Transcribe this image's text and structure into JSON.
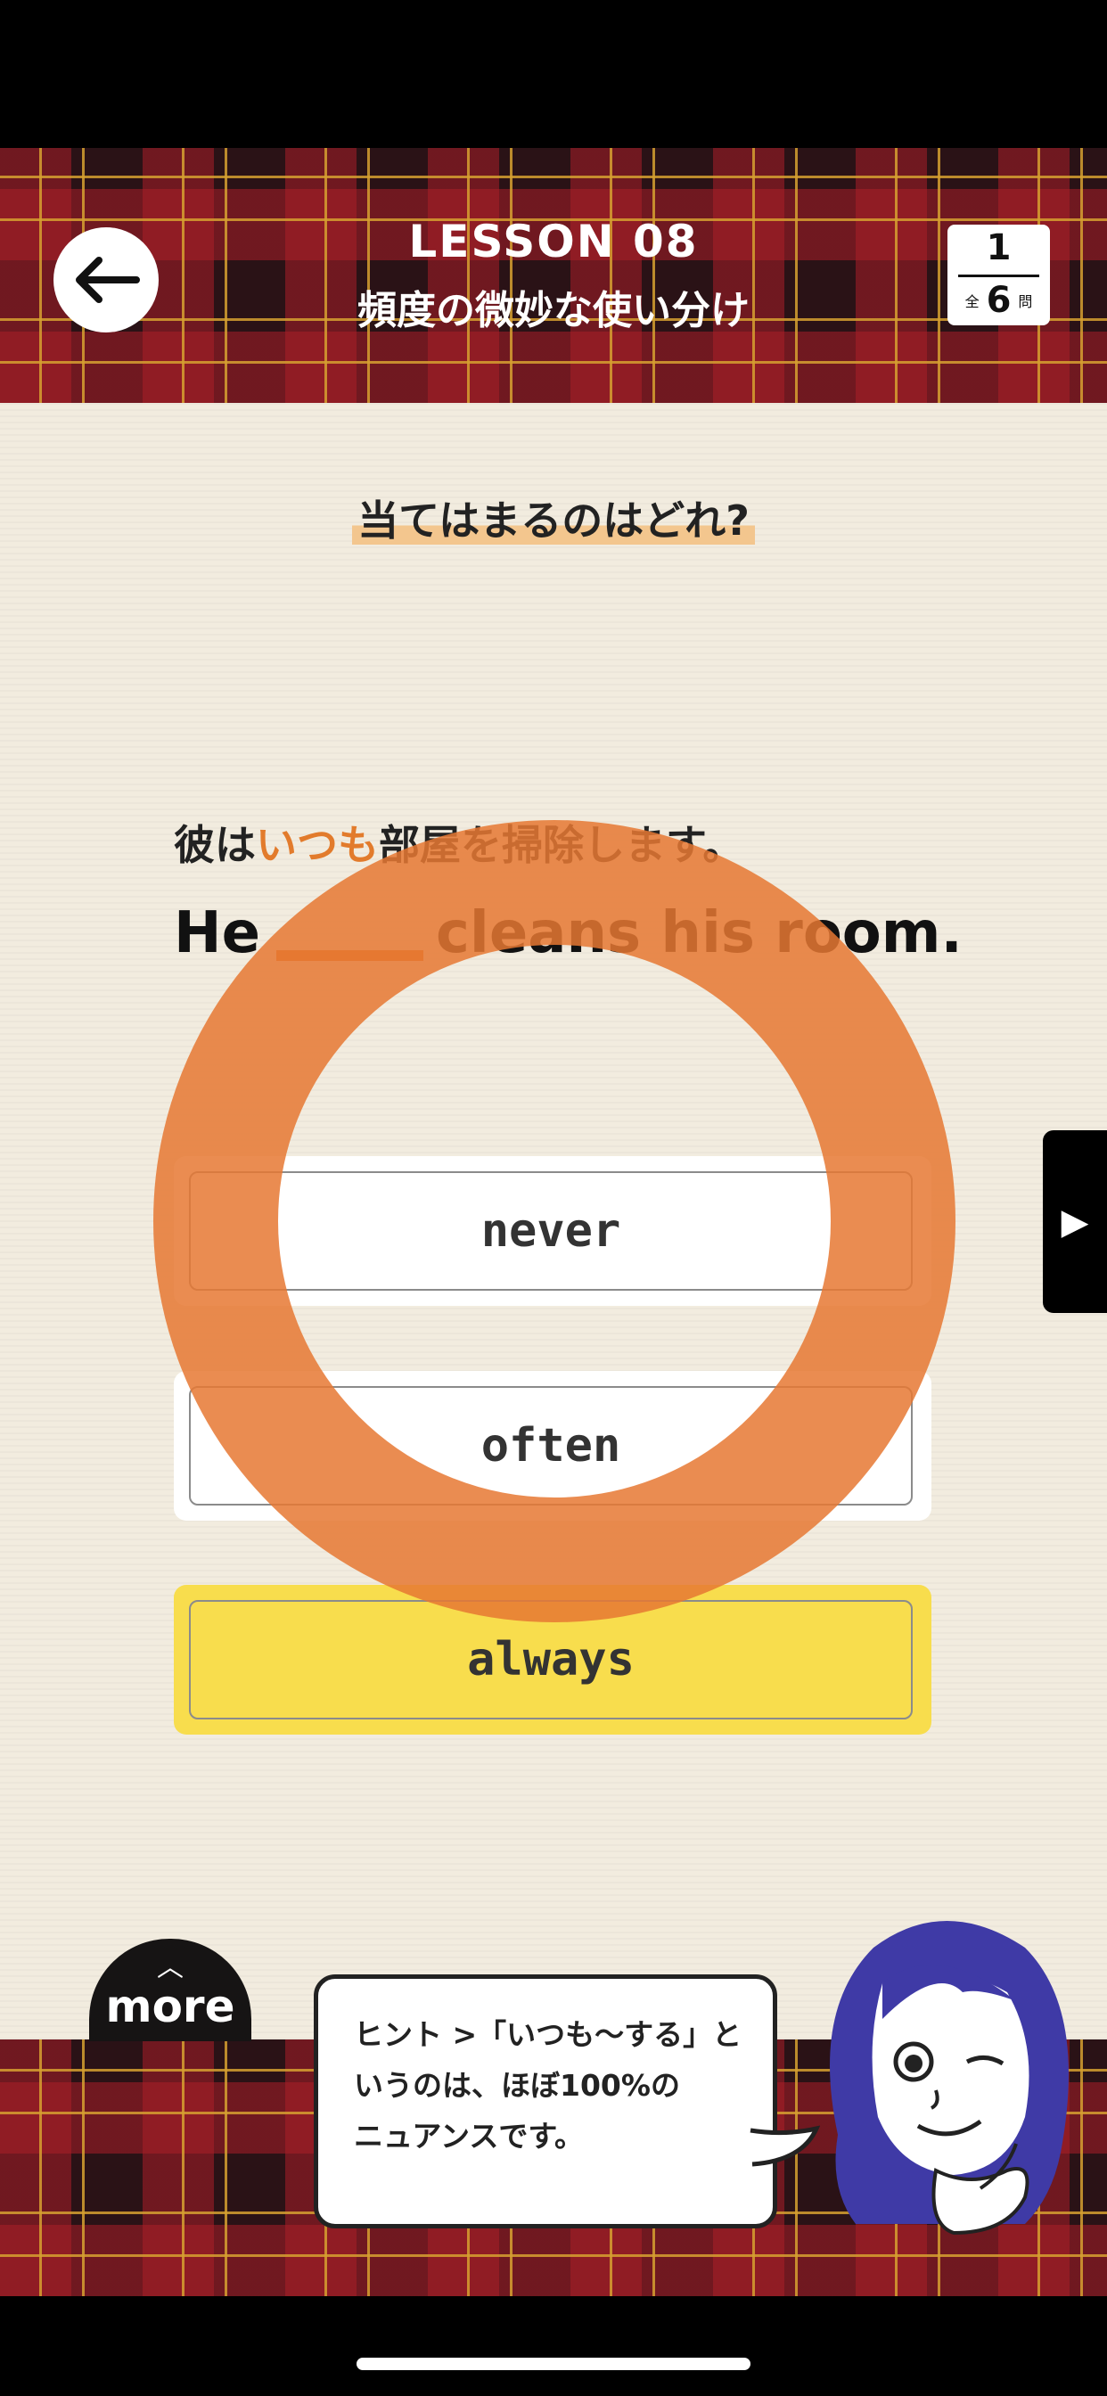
{
  "header": {
    "lesson_title": "LESSON 08",
    "lesson_subtitle": "頻度の微妙な使い分け",
    "back_icon": "arrow-left-icon",
    "counter": {
      "current": "1",
      "total_prefix": "全",
      "total": "6",
      "total_suffix": "問"
    }
  },
  "question": {
    "prompt": "当てはまるのはどれ?",
    "jp_before": "彼は",
    "jp_highlight": "いつも",
    "jp_after": "部屋を掃除します。",
    "en_before": "He",
    "en_after": "cleans his room."
  },
  "choices": [
    {
      "label": "never"
    },
    {
      "label": "often"
    },
    {
      "label": "always",
      "selected": true
    }
  ],
  "feedback": {
    "type": "correct-ring",
    "color": "#e6782f"
  },
  "next_icon": "play-right-icon",
  "more": {
    "label": "more",
    "icon": "chevron-up-icon"
  },
  "hint": {
    "line1": "ヒント >「いつも〜する」と",
    "line2": "いうのは、ほぼ100%の",
    "line3": "ニュアンスです。"
  },
  "colors": {
    "accent": "#e27b2c",
    "selected": "#f8dd4d",
    "background": "#f2ecdf"
  }
}
